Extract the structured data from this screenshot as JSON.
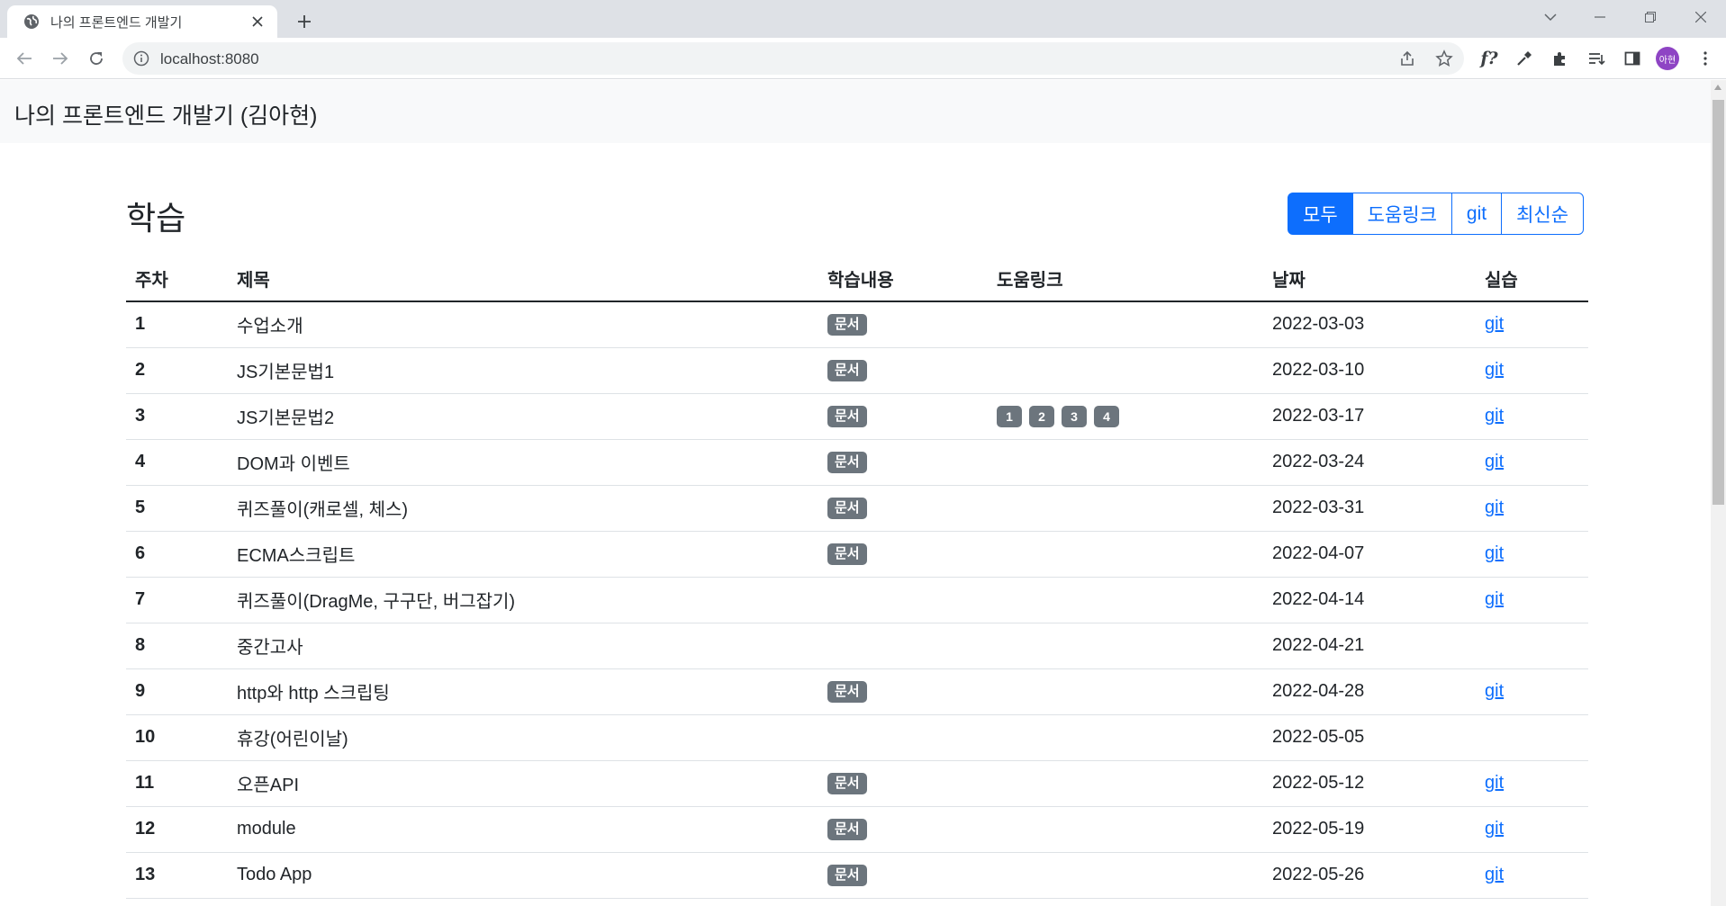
{
  "browser": {
    "tab_title": "나의 프론트엔드 개발기",
    "url": "localhost:8080",
    "profile_initials": "아현",
    "extension_text": "f?"
  },
  "navbar": {
    "brand": "나의 프론트엔드 개발기 (김아현)"
  },
  "section": {
    "title": "학습"
  },
  "filters": [
    "모두",
    "도움링크",
    "git",
    "최신순"
  ],
  "active_filter": "모두",
  "table": {
    "headers": [
      "주차",
      "제목",
      "학습내용",
      "도움링크",
      "날짜",
      "실습"
    ],
    "rows": [
      {
        "week": "1",
        "title": "수업소개",
        "doc": "문서",
        "links": [],
        "date": "2022-03-03",
        "git": "git"
      },
      {
        "week": "2",
        "title": "JS기본문법1",
        "doc": "문서",
        "links": [],
        "date": "2022-03-10",
        "git": "git"
      },
      {
        "week": "3",
        "title": "JS기본문법2",
        "doc": "문서",
        "links": [
          "1",
          "2",
          "3",
          "4"
        ],
        "date": "2022-03-17",
        "git": "git"
      },
      {
        "week": "4",
        "title": "DOM과 이벤트",
        "doc": "문서",
        "links": [],
        "date": "2022-03-24",
        "git": "git"
      },
      {
        "week": "5",
        "title": "퀴즈풀이(캐로셀, 체스)",
        "doc": "문서",
        "links": [],
        "date": "2022-03-31",
        "git": "git"
      },
      {
        "week": "6",
        "title": "ECMA스크립트",
        "doc": "문서",
        "links": [],
        "date": "2022-04-07",
        "git": "git"
      },
      {
        "week": "7",
        "title": "퀴즈풀이(DragMe, 구구단, 버그잡기)",
        "doc": "",
        "links": [],
        "date": "2022-04-14",
        "git": "git"
      },
      {
        "week": "8",
        "title": "중간고사",
        "doc": "",
        "links": [],
        "date": "2022-04-21",
        "git": ""
      },
      {
        "week": "9",
        "title": "http와 http 스크립팅",
        "doc": "문서",
        "links": [],
        "date": "2022-04-28",
        "git": "git"
      },
      {
        "week": "10",
        "title": "휴강(어린이날)",
        "doc": "",
        "links": [],
        "date": "2022-05-05",
        "git": ""
      },
      {
        "week": "11",
        "title": "오픈API",
        "doc": "문서",
        "links": [],
        "date": "2022-05-12",
        "git": "git"
      },
      {
        "week": "12",
        "title": "module",
        "doc": "문서",
        "links": [],
        "date": "2022-05-19",
        "git": "git"
      },
      {
        "week": "13",
        "title": "Todo App",
        "doc": "문서",
        "links": [],
        "date": "2022-05-26",
        "git": "git"
      }
    ]
  },
  "colors": {
    "primary": "#0d6efd",
    "badge": "#6c757d",
    "navbar_bg": "#f8f9fa",
    "tabstrip_bg": "#dee1e6"
  }
}
